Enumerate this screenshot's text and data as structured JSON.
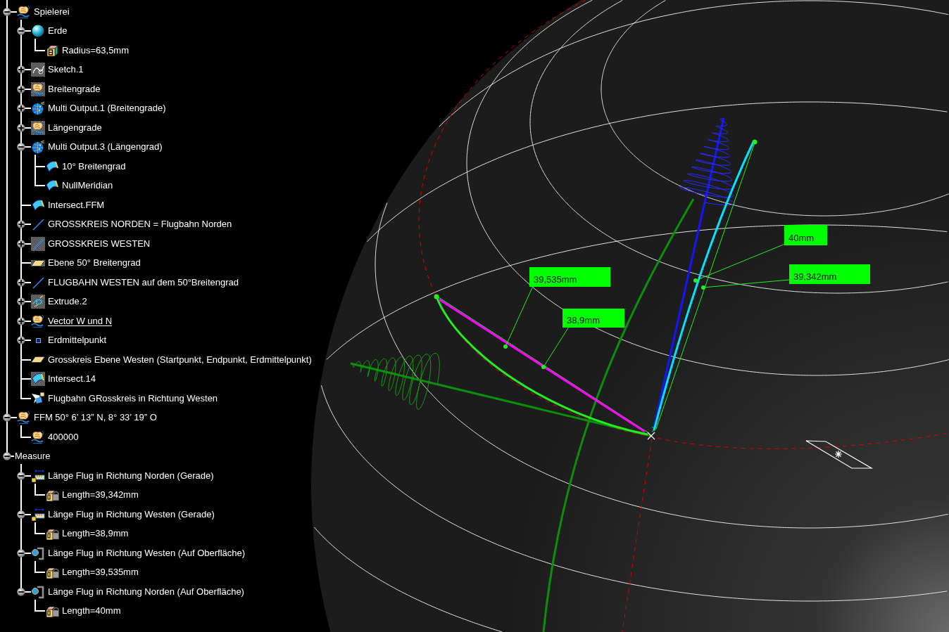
{
  "tree": {
    "nodes": [
      {
        "label": "Spielerei",
        "kind": "geoset",
        "hidden": false,
        "current": false,
        "expanded": true,
        "children": [
          {
            "label": "Erde",
            "kind": "sphere",
            "hidden": false,
            "current": false,
            "expanded": true,
            "children": [
              {
                "label": "Radius=63,5mm",
                "kind": "parameter",
                "hidden": false,
                "current": false
              }
            ]
          },
          {
            "label": "Sketch.1",
            "kind": "sketch",
            "hidden": true,
            "current": false,
            "expanded": false
          },
          {
            "label": "Breitengrade",
            "kind": "geoset",
            "hidden": true,
            "current": false,
            "expanded": false
          },
          {
            "label": "Multi Output.1 (Breitengrade)",
            "kind": "multioutput",
            "hidden": false,
            "current": false,
            "expanded": false
          },
          {
            "label": "Längengrade",
            "kind": "geoset",
            "hidden": true,
            "current": false,
            "expanded": false
          },
          {
            "label": "Multi Output.3 (Längengrad)",
            "kind": "multioutput",
            "hidden": false,
            "current": false,
            "expanded": true,
            "children": [
              {
                "label": "10° Breitengrad",
                "kind": "intersect",
                "hidden": false,
                "current": false
              },
              {
                "label": "NullMeridian",
                "kind": "intersect",
                "hidden": false,
                "current": false
              }
            ]
          },
          {
            "label": "Intersect.FFM",
            "kind": "intersect",
            "hidden": false,
            "current": false
          },
          {
            "label": "GROSSKREIS NORDEN = Flugbahn Norden",
            "kind": "line",
            "hidden": false,
            "current": false,
            "expanded": false
          },
          {
            "label": "GROSSKREIS WESTEN",
            "kind": "line",
            "hidden": true,
            "current": false,
            "expanded": false
          },
          {
            "label": "Ebene 50° Breitengrad",
            "kind": "plane",
            "hidden": true,
            "current": false
          },
          {
            "label": "FLUGBAHN WESTEN auf dem 50°Breitengrad",
            "kind": "line",
            "hidden": false,
            "current": false,
            "expanded": false
          },
          {
            "label": "Extrude.2",
            "kind": "extrude",
            "hidden": true,
            "current": false,
            "expanded": false
          },
          {
            "label": "Vector W und N",
            "kind": "geoset",
            "hidden": false,
            "current": true,
            "expanded": false
          },
          {
            "label": "Erdmittelpunkt",
            "kind": "point",
            "hidden": false,
            "current": false,
            "expanded": false
          },
          {
            "label": "Grosskreis Ebene Westen (Startpunkt, Endpunkt, Erdmittelpunkt)",
            "kind": "plane",
            "hidden": false,
            "current": false
          },
          {
            "label": "Intersect.14",
            "kind": "intersect",
            "hidden": true,
            "current": false
          },
          {
            "label": "Flugbahn GRosskreis in Richtung Westen",
            "kind": "projection",
            "hidden": false,
            "current": false
          }
        ]
      },
      {
        "label": "FFM 50° 6’ 13” N, 8° 33’ 19” O",
        "kind": "geoset",
        "hidden": false,
        "current": false,
        "expanded": true,
        "children": [
          {
            "label": "400000",
            "kind": "geoset",
            "hidden": false,
            "current": false
          }
        ]
      },
      {
        "label": "Measure",
        "kind": "measure",
        "current": false,
        "expanded": true,
        "children": [
          {
            "label": "Länge Flug in Richtung Norden (Gerade)",
            "kind": "distance",
            "hidden": false,
            "current": false,
            "expanded": true,
            "children": [
              {
                "label": "Length=39,342mm",
                "kind": "length",
                "hidden": false,
                "current": false
              }
            ]
          },
          {
            "label": "Länge Flug in Richtung Westen (Gerade)",
            "kind": "distance",
            "hidden": false,
            "current": false,
            "expanded": true,
            "children": [
              {
                "label": "Length=38,9mm",
                "kind": "length",
                "hidden": false,
                "current": false
              }
            ]
          },
          {
            "label": "Länge Flug in Richtung Westen (Auf Oberfläche)",
            "kind": "itemmeasure",
            "hidden": false,
            "current": false,
            "expanded": true,
            "children": [
              {
                "label": "Length=39,535mm",
                "kind": "length",
                "hidden": false,
                "current": false
              }
            ]
          },
          {
            "label": "Länge Flug in Richtung Norden (Auf Oberfläche)",
            "kind": "itemmeasure",
            "hidden": false,
            "current": false,
            "expanded": true,
            "children": [
              {
                "label": "Length=40mm",
                "kind": "length",
                "hidden": false,
                "current": false
              }
            ]
          }
        ]
      }
    ]
  },
  "viewport": {
    "dimension_labels": [
      "40mm",
      "39,342mm",
      "39,535mm",
      "38,9mm"
    ]
  }
}
